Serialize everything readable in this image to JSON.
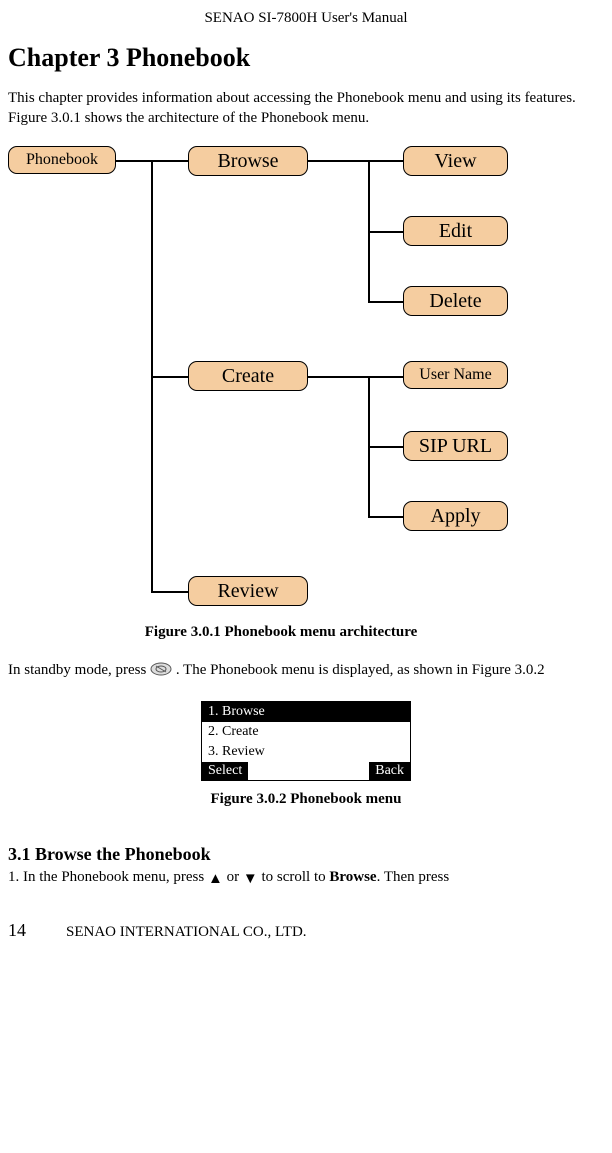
{
  "header": "SENAO SI-7800H User's Manual",
  "chapter_title": "Chapter 3 Phonebook",
  "intro": "This chapter provides information about accessing the Phonebook menu and using its features. Figure 3.0.1 shows the architecture of the Phonebook menu.",
  "nodes": {
    "phonebook": "Phonebook",
    "browse": "Browse",
    "view": "View",
    "edit": "Edit",
    "delete": "Delete",
    "create": "Create",
    "user_name": "User Name",
    "sip_url": "SIP URL",
    "apply": "Apply",
    "review": "Review"
  },
  "figure1_caption": "Figure 3.0.1 Phonebook menu architecture",
  "para1_a": "In standby mode, press ",
  "para1_b": ". The Phonebook menu is displayed, as shown in Figure 3.0.2",
  "screen": {
    "item1": "1. Browse",
    "item2": "2. Create",
    "item3": "3. Review",
    "left": "Select",
    "right": "Back"
  },
  "figure2_caption": "Figure 3.0.2 Phonebook menu",
  "section_heading": "3.1 Browse the Phonebook",
  "step_a": "1. In the Phonebook menu, press ",
  "step_or": " or ",
  "step_b": " to scroll to ",
  "step_bold": "Browse",
  "step_c": ". Then press",
  "footer_page": "14",
  "footer_company": "SENAO INTERNATIONAL CO., LTD."
}
